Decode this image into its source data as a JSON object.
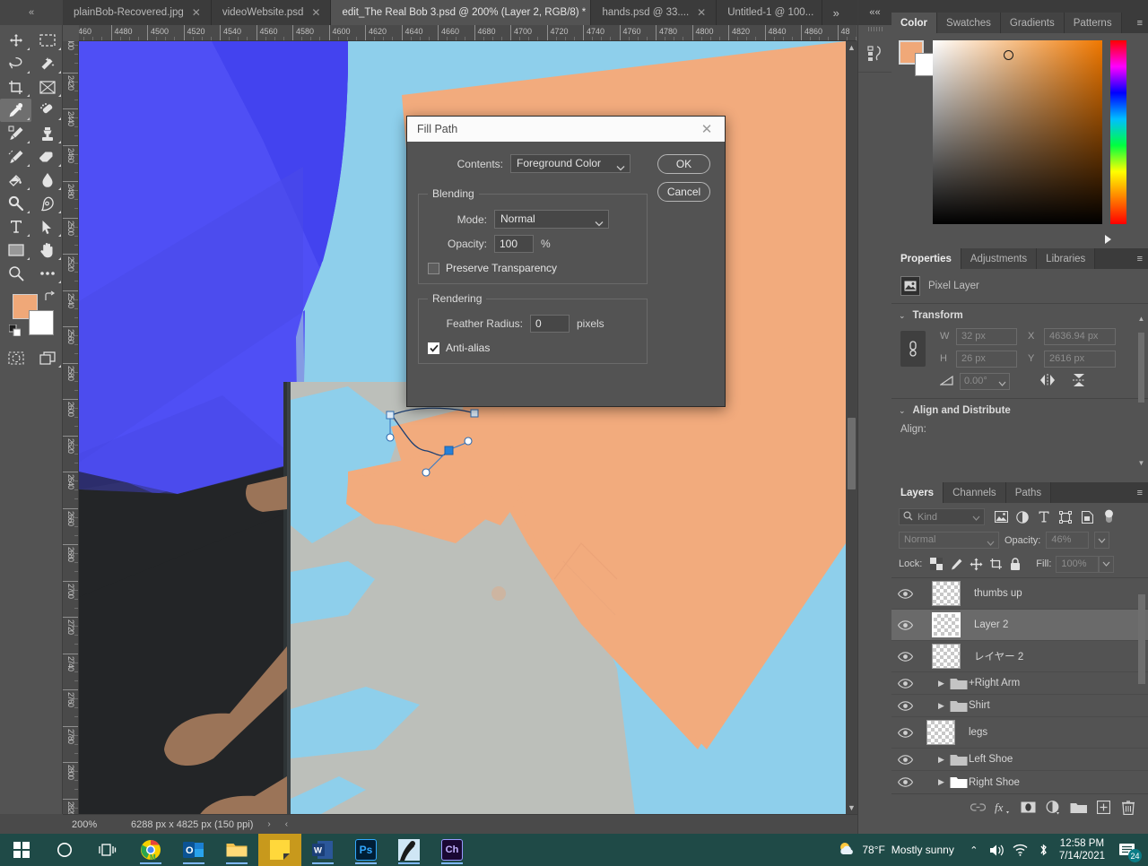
{
  "app": {
    "name": "Adobe Photoshop"
  },
  "tabbar": {
    "collapse_label": "«",
    "more_label": "»",
    "tabs": [
      {
        "label": "plainBob-Recovered.jpg",
        "close": "✕",
        "active": false
      },
      {
        "label": "videoWebsite.psd",
        "close": "✕",
        "active": false
      },
      {
        "label": "edit_The Real Bob 3.psd @ 200% (Layer 2, RGB/8) *",
        "close": "✕",
        "active": true
      },
      {
        "label": "hands.psd @ 33....",
        "close": "✕",
        "active": false
      },
      {
        "label": "Untitled-1 @ 100...",
        "close": "",
        "active": false
      }
    ]
  },
  "toolbar": {
    "tools": [
      {
        "name": "move-tool",
        "selected": false
      },
      {
        "name": "rectangular-marquee-tool",
        "selected": false
      },
      {
        "name": "lasso-tool",
        "selected": false
      },
      {
        "name": "object-selection-tool",
        "selected": false
      },
      {
        "name": "crop-tool",
        "selected": false
      },
      {
        "name": "frame-tool",
        "selected": false
      },
      {
        "name": "eyedropper-tool",
        "selected": true
      },
      {
        "name": "spot-healing-brush-tool",
        "selected": false
      },
      {
        "name": "brush-tool",
        "selected": false
      },
      {
        "name": "clone-stamp-tool",
        "selected": false
      },
      {
        "name": "history-brush-tool",
        "selected": false
      },
      {
        "name": "eraser-tool",
        "selected": false
      },
      {
        "name": "gradient-tool",
        "selected": false
      },
      {
        "name": "blur-tool",
        "selected": false
      },
      {
        "name": "dodge-tool",
        "selected": false
      },
      {
        "name": "pen-tool",
        "selected": false
      },
      {
        "name": "type-tool",
        "selected": false
      },
      {
        "name": "path-selection-tool",
        "selected": false
      },
      {
        "name": "rectangle-tool",
        "selected": false
      },
      {
        "name": "hand-tool",
        "selected": false
      },
      {
        "name": "zoom-tool",
        "selected": false
      },
      {
        "name": "edit-toolbar-tool",
        "selected": false
      }
    ],
    "foreground_color": "#f0a878",
    "background_color": "#ffffff",
    "bottom_tools": [
      {
        "name": "quick-mask-tool"
      },
      {
        "name": "screen-mode-tool"
      }
    ]
  },
  "rulers": {
    "unit": "px",
    "horizontal_ticks": [
      "460",
      "4480",
      "4500",
      "4520",
      "4540",
      "4560",
      "4580",
      "4600",
      "4620",
      "4640",
      "4660",
      "4680",
      "4700",
      "4720",
      "4740",
      "4760",
      "4780",
      "4800",
      "4820",
      "4840",
      "4860",
      "48"
    ],
    "vertical_ticks": [
      "400",
      "2420",
      "2440",
      "2460",
      "2480",
      "2500",
      "2520",
      "2540",
      "2560",
      "2580",
      "2600",
      "2620",
      "2640",
      "2660",
      "2680",
      "2700",
      "2720",
      "2740",
      "2760",
      "2780",
      "2800",
      "2820"
    ]
  },
  "canvas": {
    "colors": {
      "sky": "#8ecfeb",
      "shirt_blue": "#4f4ff5",
      "shirt_blue_dark": "#3f3fe8",
      "shirt_shade": "#4646e0",
      "dark": "#1d1f20",
      "dark2": "#2b2d2e",
      "skin": "#f2ab7d",
      "skin_dark": "#9c7258",
      "grey_hand": "#bcbfba",
      "path_stroke": "#1c3f73",
      "anchor_fill": "#ffffff",
      "anchor_selected": "#2680d8",
      "handle_line": "#3a7bc4"
    }
  },
  "statusbar": {
    "zoom": "200%",
    "doc_size": "6288 px x 4825 px (150 ppi)",
    "arrow_right": "›",
    "arrow_left": "‹"
  },
  "mini_strip": {
    "collapse_label": "««",
    "icons": [
      {
        "name": "history-actions-icon"
      }
    ]
  },
  "color_panel": {
    "tabs": [
      {
        "label": "Color",
        "active": true
      },
      {
        "label": "Swatches",
        "active": false
      },
      {
        "label": "Gradients",
        "active": false
      },
      {
        "label": "Patterns",
        "active": false
      }
    ],
    "menu": "≡",
    "foreground_color": "#f0a878",
    "background_color": "#ffffff"
  },
  "properties_panel": {
    "tabs": [
      {
        "label": "Properties",
        "active": true
      },
      {
        "label": "Adjustments",
        "active": false
      },
      {
        "label": "Libraries",
        "active": false
      }
    ],
    "menu": "≡",
    "layer_kind": "Pixel Layer",
    "transform": {
      "title": "Transform",
      "chevron": "⌄",
      "w_label": "W",
      "w_value": "32 px",
      "h_label": "H",
      "h_value": "26 px",
      "x_label": "X",
      "x_value": "4636.94 px",
      "y_label": "Y",
      "y_value": "2616 px",
      "angle_value": "0.00°",
      "angle_chevron": "⌄"
    },
    "align": {
      "title": "Align and Distribute",
      "chevron": "⌄",
      "label": "Align:"
    }
  },
  "layers_panel": {
    "tabs": [
      {
        "label": "Layers",
        "active": true
      },
      {
        "label": "Channels",
        "active": false
      },
      {
        "label": "Paths",
        "active": false
      }
    ],
    "menu": "≡",
    "filter_kind": "Kind",
    "filter_chevron": "⌄",
    "blend_mode": "Normal",
    "blend_chevron": "⌄",
    "opacity_label": "Opacity:",
    "opacity_value": "46%",
    "lock_label": "Lock:",
    "fill_label": "Fill:",
    "fill_value": "100%",
    "stepper_chevron": "⌄",
    "layers": [
      {
        "name": "thumbs up",
        "type": "pixel",
        "visible": true,
        "selected": false
      },
      {
        "name": "Layer 2",
        "type": "pixel",
        "visible": true,
        "selected": true
      },
      {
        "name": "レイヤー 2",
        "type": "pixel",
        "visible": true,
        "selected": false
      },
      {
        "name": "+Right Arm",
        "type": "group",
        "visible": true,
        "selected": false
      },
      {
        "name": "Shirt",
        "type": "group",
        "visible": true,
        "selected": false
      },
      {
        "name": "legs",
        "type": "pixel",
        "visible": true,
        "selected": false
      },
      {
        "name": "Left Shoe",
        "type": "group",
        "visible": true,
        "selected": false
      },
      {
        "name": "Right Shoe",
        "type": "group",
        "visible": true,
        "selected": false
      }
    ],
    "bottom_buttons": [
      {
        "name": "link-layers-icon",
        "label": "link"
      },
      {
        "name": "layer-style-fx-icon",
        "label": "fx"
      },
      {
        "name": "add-layer-mask-icon",
        "label": "mask"
      },
      {
        "name": "new-adjustment-layer-icon",
        "label": "adjustment"
      },
      {
        "name": "new-group-icon",
        "label": "group"
      },
      {
        "name": "new-layer-icon",
        "label": "new"
      },
      {
        "name": "delete-layer-icon",
        "label": "delete"
      }
    ]
  },
  "dialog": {
    "title": "Fill Path",
    "close": "✕",
    "contents_label": "Contents:",
    "contents_value": "Foreground Color",
    "contents_chevron": "⌄",
    "ok_label": "OK",
    "cancel_label": "Cancel",
    "blending": {
      "legend": "Blending",
      "mode_label": "Mode:",
      "mode_value": "Normal",
      "mode_chevron": "⌄",
      "opacity_label": "Opacity:",
      "opacity_value": "100",
      "opacity_unit": "%",
      "preserve_label": "Preserve Transparency",
      "preserve_checked": false
    },
    "rendering": {
      "legend": "Rendering",
      "feather_label": "Feather Radius:",
      "feather_value": "0",
      "feather_unit": "pixels",
      "antialias_label": "Anti-alias",
      "antialias_checked": true
    }
  },
  "taskbar": {
    "items": [
      {
        "name": "start-button",
        "label": "⊞"
      },
      {
        "name": "cortana-search-button",
        "label": "◯"
      },
      {
        "name": "task-view-button",
        "label": "❘❙❘"
      },
      {
        "name": "chrome-taskbar-icon",
        "label": ""
      },
      {
        "name": "outlook-taskbar-icon",
        "label": "O"
      },
      {
        "name": "file-explorer-taskbar-icon",
        "label": ""
      },
      {
        "name": "sticky-notes-taskbar-icon",
        "label": ""
      },
      {
        "name": "word-taskbar-icon",
        "label": "W"
      },
      {
        "name": "photoshop-taskbar-icon",
        "label": "Ps"
      },
      {
        "name": "krita-taskbar-icon",
        "label": ""
      },
      {
        "name": "character-animator-taskbar-icon",
        "label": "Ch"
      }
    ],
    "weather_temp": "78°F",
    "weather_desc": "Mostly sunny",
    "tray_chevron": "⌃",
    "time": "12:58 PM",
    "date": "7/14/2021",
    "notification_count": "24"
  }
}
